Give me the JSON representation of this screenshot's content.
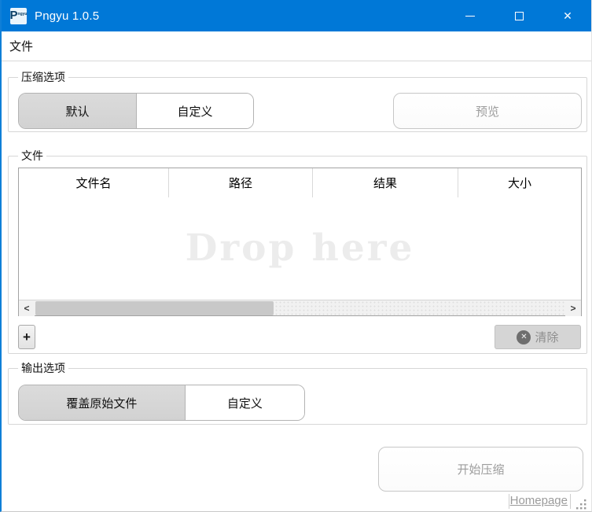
{
  "window": {
    "title": "Pngyu 1.0.5",
    "icon_letter": "P",
    "icon_sub": "ngyu",
    "accent_color": "#0078d7"
  },
  "icons": {
    "close_glyph": "✕",
    "clear_x_glyph": "✕",
    "scroll_left_glyph": "<",
    "scroll_right_glyph": ">"
  },
  "menubar": {
    "items": [
      {
        "label": "文件"
      }
    ]
  },
  "compress_options": {
    "group_label": "压缩选项",
    "segments": [
      {
        "label": "默认",
        "selected": true
      },
      {
        "label": "自定义",
        "selected": false
      }
    ],
    "preview_label": "预览"
  },
  "files": {
    "group_label": "文件",
    "columns": [
      "文件名",
      "路径",
      "结果",
      "大小"
    ],
    "rows": [],
    "drop_hint": "Drop here",
    "add_label": "+",
    "clear_label": "清除",
    "scrollbar": {
      "orientation": "horizontal",
      "thumb_fraction": 0.45
    }
  },
  "output_options": {
    "group_label": "输出选项",
    "segments": [
      {
        "label": "覆盖原始文件",
        "selected": true
      },
      {
        "label": "自定义",
        "selected": false
      }
    ]
  },
  "footer": {
    "start_label": "开始压缩",
    "homepage_label": "Homepage"
  },
  "colors": {
    "titlebar": "#0078d7",
    "selected_segment": "#d6d6d6",
    "disabled_text": "#9d9d9d",
    "drop_hint_text": "#ececec",
    "groupbox_border": "#d7d7d7",
    "table_border": "#a3a3a3"
  }
}
